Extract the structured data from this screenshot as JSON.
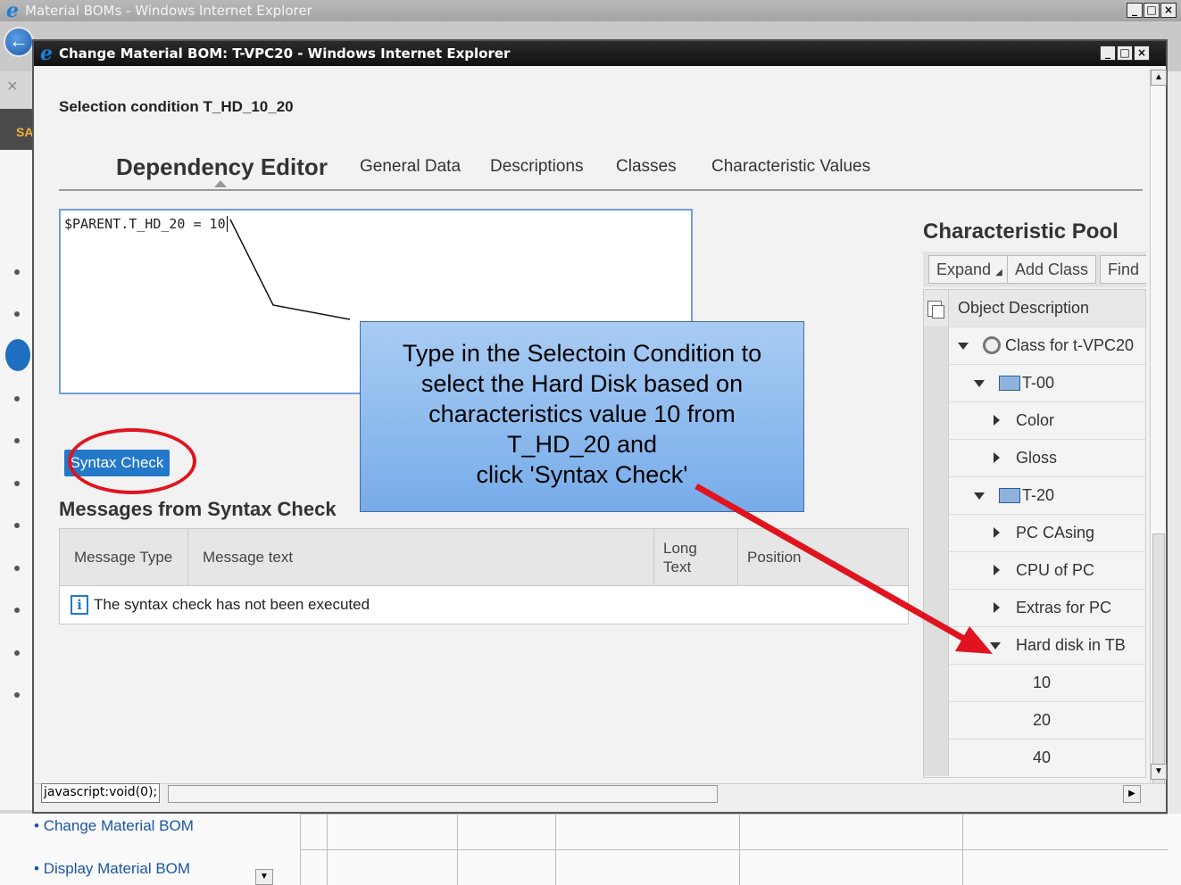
{
  "outer_window": {
    "title": "Material BOMs - Windows Internet Explorer",
    "min": "_",
    "max": "□",
    "close": "×",
    "back": "←",
    "close_x": "×",
    "sap_badge": "SA",
    "links": [
      "Change Material BOM",
      "Display Material BOM"
    ],
    "dropdown_arrow": "▼"
  },
  "popup": {
    "title": "Change Material BOM: T-VPC20 - Windows Internet Explorer",
    "min": "_",
    "max": "□",
    "close": "×",
    "status_url": "javascript:void(0);",
    "scroll_up": "▲",
    "scroll_down": "▼",
    "scroll_right": "▶"
  },
  "header": {
    "selection_condition": "Selection condition T_HD_10_20"
  },
  "tabs": {
    "active": "Dependency Editor",
    "items": [
      "General Data",
      "Descriptions",
      "Classes",
      "Characteristic Values"
    ]
  },
  "editor": {
    "value": "$PARENT.T_HD_20 = 10"
  },
  "syntax_check": {
    "label": "Syntax Check"
  },
  "messages": {
    "title": "Messages from Syntax Check",
    "columns": [
      "Message Type",
      "Message text",
      "Long Text",
      "Position"
    ],
    "row_text": "The syntax check has not been executed",
    "info_glyph": "i"
  },
  "callout": {
    "lines": [
      "Type in the Selectoin Condition to",
      "select the Hard Disk based on",
      "characteristics value 10 from",
      "T_HD_20 and",
      "click 'Syntax Check'"
    ]
  },
  "pool": {
    "title": "Characteristic Pool",
    "toolbar": [
      "Expand",
      "Add Class",
      "Find"
    ],
    "header": "Object Description",
    "rows": [
      {
        "label": "Class for t-VPC20",
        "icon": "class-ring-icon",
        "expanded": true
      },
      {
        "label": "T-00",
        "icon": "folder-icon",
        "expanded": true
      },
      {
        "label": "Color",
        "expanded": false
      },
      {
        "label": "Gloss",
        "expanded": false
      },
      {
        "label": "T-20",
        "icon": "folder-icon",
        "expanded": true
      },
      {
        "label": "PC CAsing",
        "expanded": false
      },
      {
        "label": "CPU of PC",
        "expanded": false
      },
      {
        "label": "Extras for PC",
        "expanded": false
      },
      {
        "label": "Hard disk in TB",
        "expanded": true
      },
      {
        "label": "10"
      },
      {
        "label": "20"
      },
      {
        "label": "40"
      }
    ]
  },
  "colors": {
    "accent_blue": "#2378c8",
    "annotation_red": "#e0141e",
    "callout_blue": "#77acea"
  }
}
